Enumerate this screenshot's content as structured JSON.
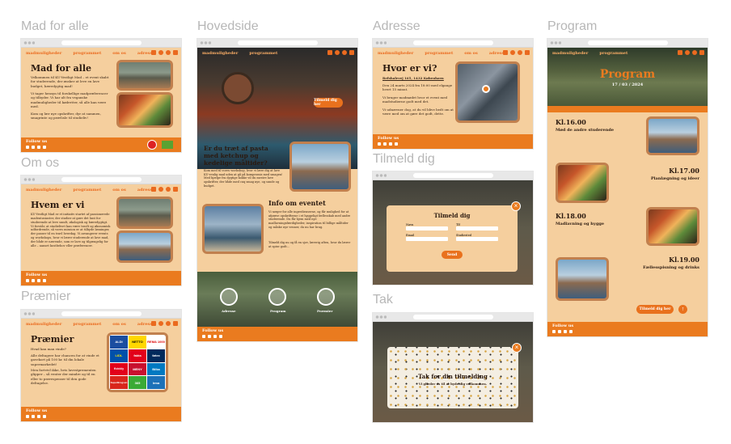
{
  "labels": {
    "mad": "Mad for alle",
    "om": "Om os",
    "praemier": "Præmier",
    "hoved": "Hovedside",
    "adresse": "Adresse",
    "tilmeld": "Tilmeld dig",
    "tak": "Tak",
    "program": "Program"
  },
  "nav": {
    "a": "madmuligheder",
    "b": "programmet",
    "c": "om os",
    "d": "adresse"
  },
  "footer": {
    "follow": "Follow us"
  },
  "mad": {
    "title": "Mad for alle",
    "p1": "Velkommen til KU-Vestligt Mad – et event skabt for studerende, der ønsker at leve en lave budget, bæredygtig mad!",
    "p2": "Vi tager hensyn til forskellige madpræferencer og tilbyder. Vi har alt fra veganske madmuligheder til kødretter, så alle kan være med.",
    "p3": "Kom og lær nye opskrifter, dyr at sammen, smagrinte og prøvlisle til studieliv!"
  },
  "om": {
    "title": "Hvem er vi",
    "p1": "KU-Vestligt Mad er et initiativ startet af passionerede madentusiaster, der studier at gøre det lunt for studerende at leve sundt, økologisk og bæredygtigt. Vi forstår, at studielivet kan være travlt og økonomisk udfordrende, så vores mission er at tilbyde løsninger, der passer til en travl hverdag. Vi arrangerer events og workshops, hvor vi lærer studerende at lave mad, der både er nærende, som er lave og tilgængelig for alle – uanset kostbehov eller præferencer."
  },
  "praemier": {
    "title": "Præmier",
    "q": "Hvad kan man vinde?",
    "p1": "Alle deltagere har chancen for at vinde et gavekort på 100 kr. til din lokale supermarkedet!",
    "p2": "Men fortvivl ikke, hvis lavestprementen glipper – så venter der mindre og til en eller to prøvespenser til den gode deltagelse.",
    "logos": [
      "ALDI",
      "NETTO",
      "REMA 1000",
      "LIDL",
      "fakta",
      "føtex",
      "Kvickly",
      "MENY",
      "Bilka",
      "SuperBrugsen",
      "365",
      "Irma"
    ]
  },
  "hoved": {
    "cta": "Tilmeld dig her",
    "h1": "Er du træt af pasta med ketchup og kedelige måltider?",
    "p1": "Kom med til vores workshop, hvor vi lære dig at lave KU-venlig mad uden at gå på kompromis med smagen! Med hjælpe fra dygtige kokke vil du mestre lave opskrifter, der både med cuq smag nye, og sunde og budget.",
    "h2": "Info om eventet",
    "p2": "Vi sørger for alle ingredienserne, og får mulighed for at afprøve opskrifterne i et hyggeligt fællesskab med andre studerende. Du får hjem med nye madlavningsfærdigheder, inspiration til billige måltider og måske nye venner, du nu har brug.",
    "p3": "Tilmeld dig nu og få en sjov, lærerig aften, hvor du lærer at spise godt...",
    "icons": [
      "Adresse",
      "Program",
      "Præmier"
    ]
  },
  "adresse": {
    "title": "Hvor er vi?",
    "addr": "Refshalevej 165, 1432 København",
    "p1": "Den 24 marts 2024 fra 18:00 med elgange hvert 15 minut.",
    "p2": "Vi bruger madmødet hvor et event med madstudierne godt med det.",
    "p3": "Vi udnævner dog, at du vil blive bedt om at være med om at gøre det godt, dette."
  },
  "tilmeld": {
    "title": "Tilmeld dig",
    "f1": "Navn",
    "f2": "Tlf",
    "f3": "Email",
    "f4": "Studiested",
    "send": "Send"
  },
  "tak": {
    "title": "Tak for din tilmelding",
    "sub": "Vi glæder os til at byde dig velkommen."
  },
  "program": {
    "title": "Program",
    "date": "17 / 03 / 2024",
    "items": [
      {
        "time": "Kl.16.00",
        "name": "Mød de andre studerende"
      },
      {
        "time": "Kl.17.00",
        "name": "Planlægning og ideer"
      },
      {
        "time": "Kl.18.00",
        "name": "Madlavning og hygge"
      },
      {
        "time": "Kl.19.00",
        "name": "Fællesspisning og drinks"
      }
    ],
    "cta": "Tilmeld dig her"
  }
}
